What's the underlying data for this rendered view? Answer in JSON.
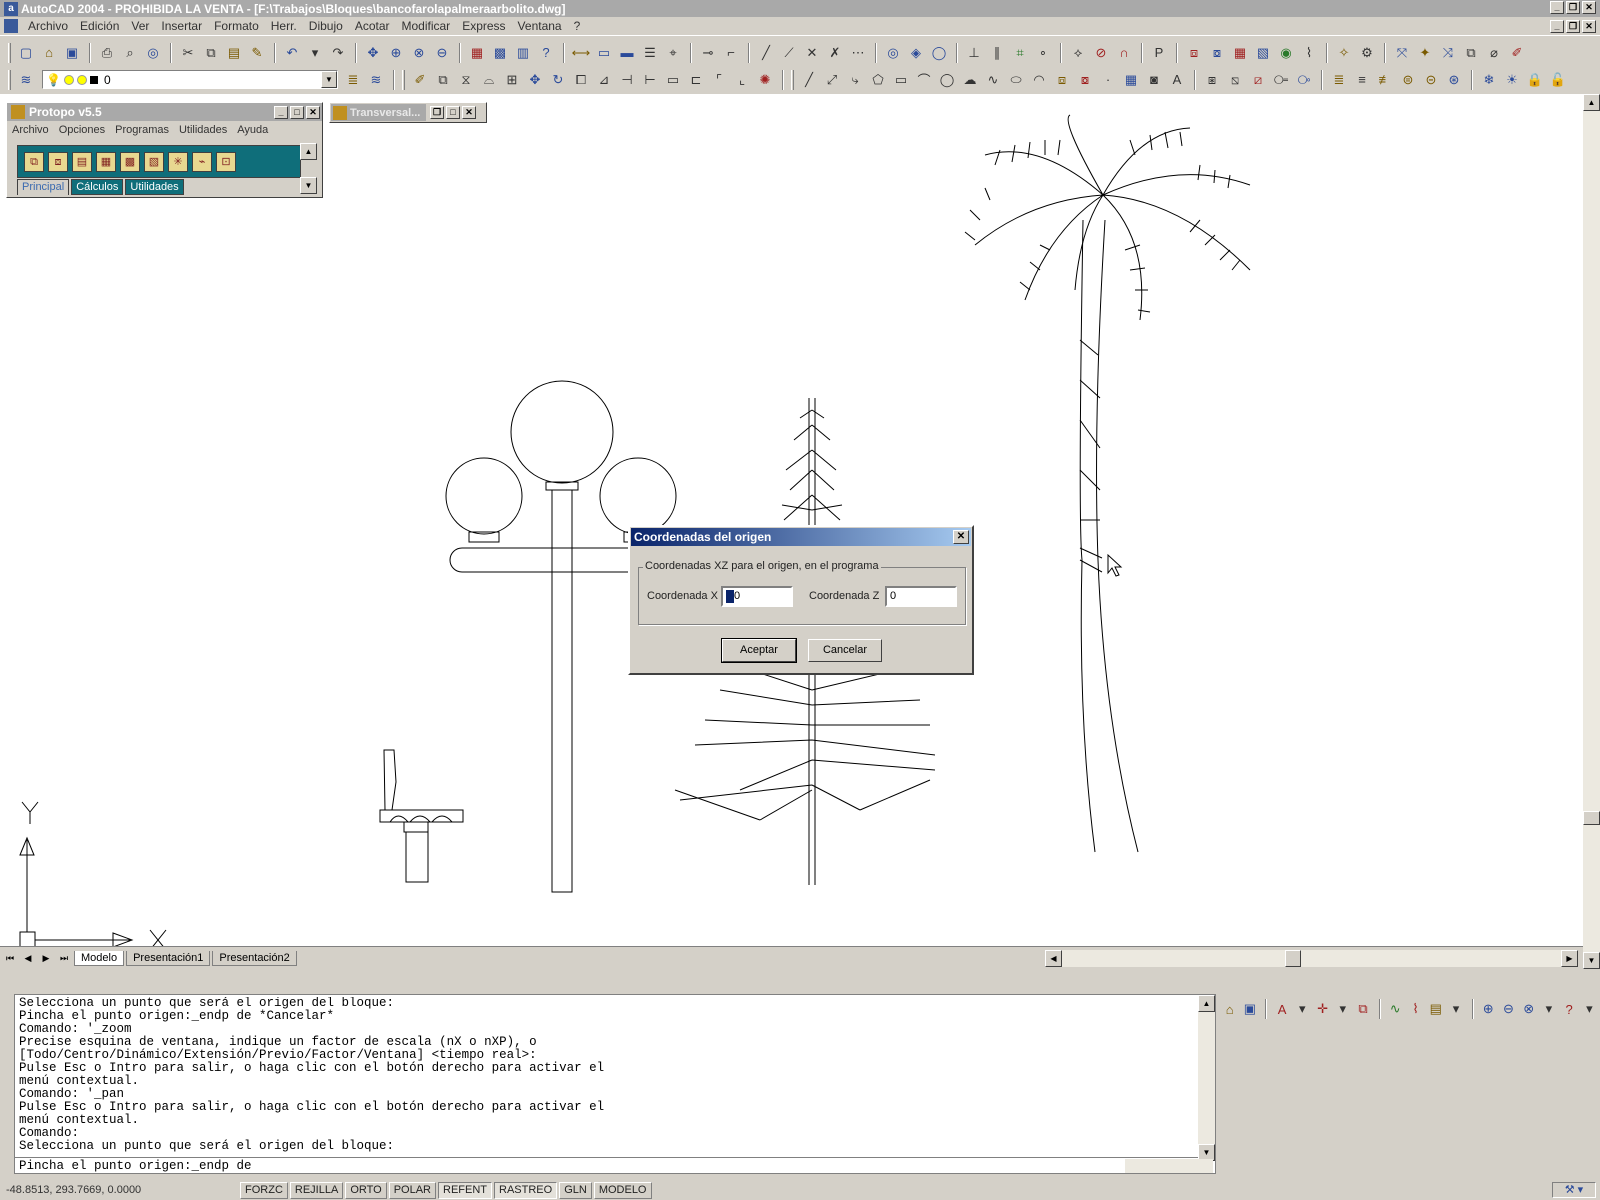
{
  "window": {
    "title": "AutoCAD 2004 - PROHIBIDA LA VENTA - [F:\\Trabajos\\Bloques\\bancofarolapalmeraarbolito.dwg]"
  },
  "menubar": {
    "items": [
      "Archivo",
      "Edición",
      "Ver",
      "Insertar",
      "Formato",
      "Herr.",
      "Dibujo",
      "Acotar",
      "Modificar",
      "Express",
      "Ventana",
      "?"
    ]
  },
  "layer": {
    "current": "0",
    "colors": [
      "#ffff00",
      "#ffff00",
      "#000000"
    ]
  },
  "palette": {
    "title": "Protopo v5.5",
    "menu": [
      "Archivo",
      "Opciones",
      "Programas",
      "Utilidades",
      "Ayuda"
    ],
    "tabs": [
      "Principal",
      "Cálculos",
      "Utilidades"
    ],
    "active_tab": "Principal"
  },
  "minimized_window": {
    "title": "Transversal..."
  },
  "ucs": {
    "x_label": "X",
    "y_label": "Y"
  },
  "layout_tabs": [
    "Modelo",
    "Presentación1",
    "Presentación2"
  ],
  "dialog": {
    "title": "Coordenadas del origen",
    "group_label": "Coordenadas XZ para el origen, en el programa",
    "x_label": "Coordenada X",
    "x_value": "0",
    "z_label": "Coordenada Z",
    "z_value": "0",
    "ok_label": "Aceptar",
    "cancel_label": "Cancelar"
  },
  "command_window": {
    "history": "Selecciona un punto que será el origen del bloque:\nPincha el punto origen:_endp de *Cancelar*\nComando: '_zoom\nPrecise esquina de ventana, indique un factor de escala (nX o nXP), o\n[Todo/Centro/Dinámico/Extensión/Previo/Factor/Ventana] <tiempo real>:\nPulse Esc o Intro para salir, o haga clic con el botón derecho para activar el\nmenú contextual.\nComando: '_pan\nPulse Esc o Intro para salir, o haga clic con el botón derecho para activar el\nmenú contextual.\nComando:\nSelecciona un punto que será el origen del bloque:",
    "prompt": "Pincha el punto origen:_endp de"
  },
  "statusbar": {
    "coordinates": "-48.8513, 293.7669, 0.0000",
    "modes": [
      {
        "label": "FORZC",
        "on": false
      },
      {
        "label": "REJILLA",
        "on": false
      },
      {
        "label": "ORTO",
        "on": false
      },
      {
        "label": "POLAR",
        "on": false
      },
      {
        "label": "REFENT",
        "on": true
      },
      {
        "label": "RASTREO",
        "on": true
      },
      {
        "label": "GLN",
        "on": false
      },
      {
        "label": "MODELO",
        "on": false
      }
    ]
  }
}
